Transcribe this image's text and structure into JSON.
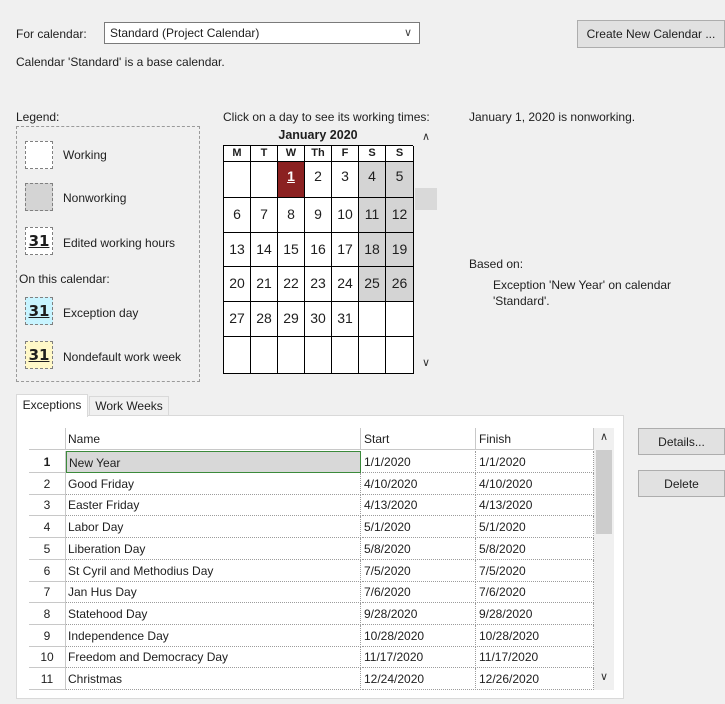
{
  "header": {
    "for_calendar_label": "For calendar:",
    "calendar_value": "Standard (Project Calendar)",
    "create_button": "Create New Calendar ...",
    "base_note": "Calendar 'Standard' is a base calendar."
  },
  "legend": {
    "title": "Legend:",
    "working": "Working",
    "nonworking": "Nonworking",
    "edited": "Edited working hours",
    "on_this": "On this calendar:",
    "exception": "Exception day",
    "nondefault": "Nondefault work week",
    "sample_day": "31"
  },
  "calendar": {
    "instruction": "Click on a day to see its working times:",
    "month": "January 2020",
    "weekdays": [
      "M",
      "T",
      "W",
      "Th",
      "F",
      "S",
      "S"
    ],
    "weeks": [
      [
        "",
        "",
        "1",
        "2",
        "3",
        "4",
        "5"
      ],
      [
        "6",
        "7",
        "8",
        "9",
        "10",
        "11",
        "12"
      ],
      [
        "13",
        "14",
        "15",
        "16",
        "17",
        "18",
        "19"
      ],
      [
        "20",
        "21",
        "22",
        "23",
        "24",
        "25",
        "26"
      ],
      [
        "27",
        "28",
        "29",
        "30",
        "31",
        "",
        ""
      ],
      [
        "",
        "",
        "",
        "",
        "",
        "",
        ""
      ]
    ],
    "selected_day": "1"
  },
  "info": {
    "status": "January 1, 2020 is nonworking.",
    "based_on": "Based on:",
    "detail": "Exception 'New Year' on calendar 'Standard'."
  },
  "tabs": [
    "Exceptions",
    "Work Weeks"
  ],
  "table": {
    "headers": [
      "Name",
      "Start",
      "Finish"
    ],
    "rows": [
      [
        "1",
        "New Year",
        "1/1/2020",
        "1/1/2020"
      ],
      [
        "2",
        "Good Friday",
        "4/10/2020",
        "4/10/2020"
      ],
      [
        "3",
        "Easter Friday",
        "4/13/2020",
        "4/13/2020"
      ],
      [
        "4",
        "Labor Day",
        "5/1/2020",
        "5/1/2020"
      ],
      [
        "5",
        "Liberation Day",
        "5/8/2020",
        "5/8/2020"
      ],
      [
        "6",
        "St Cyril and Methodius Day",
        "7/5/2020",
        "7/5/2020"
      ],
      [
        "7",
        "Jan Hus Day",
        "7/6/2020",
        "7/6/2020"
      ],
      [
        "8",
        "Statehood Day",
        "9/28/2020",
        "9/28/2020"
      ],
      [
        "9",
        "Independence Day",
        "10/28/2020",
        "10/28/2020"
      ],
      [
        "10",
        "Freedom and Democracy Day",
        "11/17/2020",
        "11/17/2020"
      ],
      [
        "11",
        "Christmas",
        "12/24/2020",
        "12/26/2020"
      ]
    ]
  },
  "buttons": {
    "details": "Details...",
    "delete": "Delete"
  },
  "colors": {
    "background": "#f0f0f0",
    "nonworking": "#d4d4d4",
    "selected_day": "#8b2121",
    "exception_day": "#c8f4ff",
    "nondefault_week": "#fff8c8",
    "selected_row": "#d8d8d8",
    "selected_row_border": "#3b8a3b"
  }
}
